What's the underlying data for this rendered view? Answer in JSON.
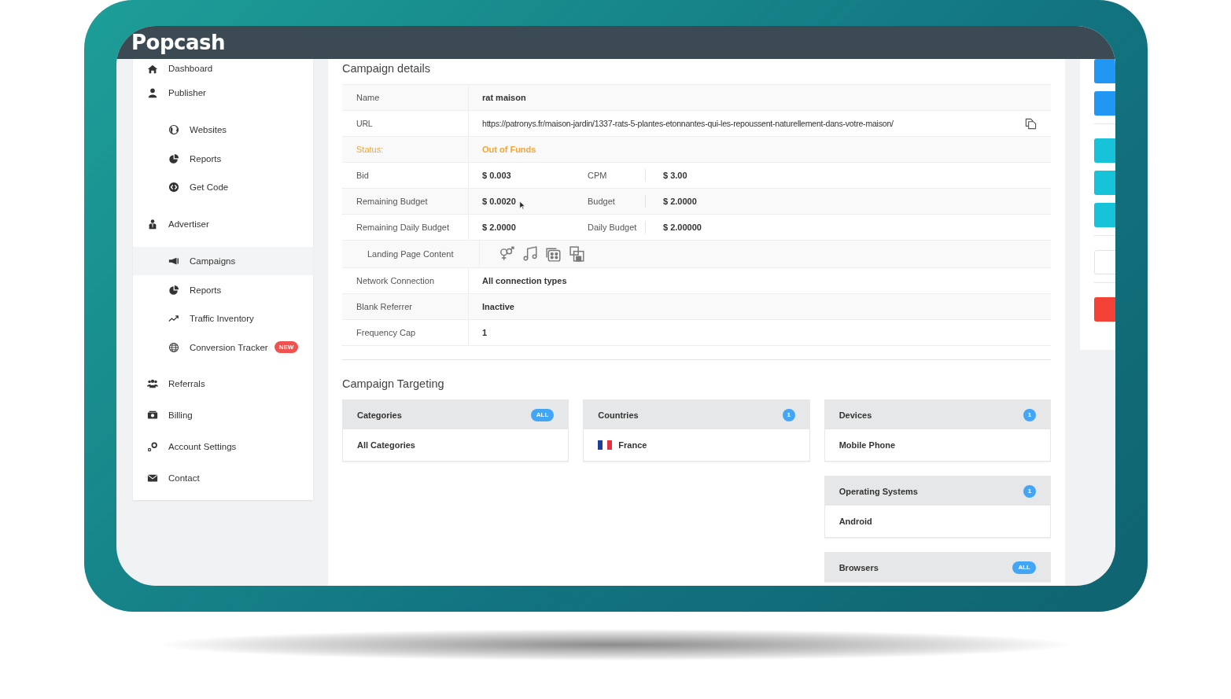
{
  "app": {
    "logo": "Popcash"
  },
  "sidebar": {
    "items": [
      {
        "label": "Dashboard",
        "selected": false
      },
      {
        "label": "Publisher",
        "selected": false,
        "children": [
          {
            "label": "Websites",
            "selected": false
          },
          {
            "label": "Reports",
            "selected": false
          },
          {
            "label": "Get Code",
            "selected": false
          }
        ]
      },
      {
        "label": "Advertiser",
        "selected": false,
        "children": [
          {
            "label": "Campaigns",
            "selected": true
          },
          {
            "label": "Reports",
            "selected": false
          },
          {
            "label": "Traffic Inventory",
            "selected": false
          },
          {
            "label": "Conversion Tracker",
            "selected": false,
            "badge": "NEW"
          }
        ]
      },
      {
        "label": "Referrals",
        "selected": false
      },
      {
        "label": "Billing",
        "selected": false
      },
      {
        "label": "Account Settings",
        "selected": false
      },
      {
        "label": "Contact",
        "selected": false
      }
    ]
  },
  "campaign_details": {
    "title": "Campaign details",
    "rows": [
      {
        "kind": "text",
        "label": "Name",
        "value": "rat maison"
      },
      {
        "kind": "url",
        "label": "URL",
        "value": "https://patronys.fr/maison-jardin/1337-rats-5-plantes-etonnantes-qui-les-repoussent-naturellement-dans-votre-maison/"
      },
      {
        "kind": "status",
        "label": "Status:",
        "value": "Out of Funds"
      },
      {
        "kind": "pair",
        "label": "Bid",
        "value": "$ 0.003",
        "label_2": "CPM",
        "value_2": "$ 3.00"
      },
      {
        "kind": "pair",
        "label": "Remaining Budget",
        "value": "$ 0.0020",
        "label_2": "Budget",
        "value_2": "$ 2.0000",
        "pointer": true
      },
      {
        "kind": "pair",
        "label": "Remaining Daily Budget",
        "value": "$ 2.0000",
        "label_2": "Daily Budget",
        "value_2": "$ 2.00000"
      },
      {
        "kind": "icons",
        "label": "Landing Page Content"
      },
      {
        "kind": "text",
        "label": "Network Connection",
        "value": "All connection types"
      },
      {
        "kind": "text",
        "label": "Blank Referrer",
        "value": "Inactive"
      },
      {
        "kind": "plain",
        "label": "Frequency Cap",
        "value": "1"
      }
    ]
  },
  "campaign_targeting": {
    "title": "Campaign Targeting",
    "columns": [
      [
        {
          "title": "Categories",
          "badge": "ALL",
          "items": [
            {
              "kind": "text",
              "label": "All Categories"
            }
          ]
        }
      ],
      [
        {
          "title": "Countries",
          "badge": "1",
          "items": [
            {
              "kind": "country",
              "label": "France"
            }
          ]
        }
      ],
      [
        {
          "title": "Devices",
          "badge": "1",
          "items": [
            {
              "kind": "text",
              "label": "Mobile Phone"
            }
          ]
        },
        {
          "title": "Operating Systems",
          "badge": "1",
          "items": [
            {
              "kind": "text",
              "label": "Android"
            }
          ]
        },
        {
          "title": "Browsers",
          "badge": "ALL"
        }
      ]
    ]
  },
  "right_panel": {
    "buttons": [
      {
        "kind": "primary"
      },
      {
        "kind": "primary"
      },
      {
        "kind": "info"
      },
      {
        "kind": "info"
      },
      {
        "kind": "info"
      },
      {
        "kind": "default"
      },
      {
        "kind": "danger"
      }
    ]
  }
}
